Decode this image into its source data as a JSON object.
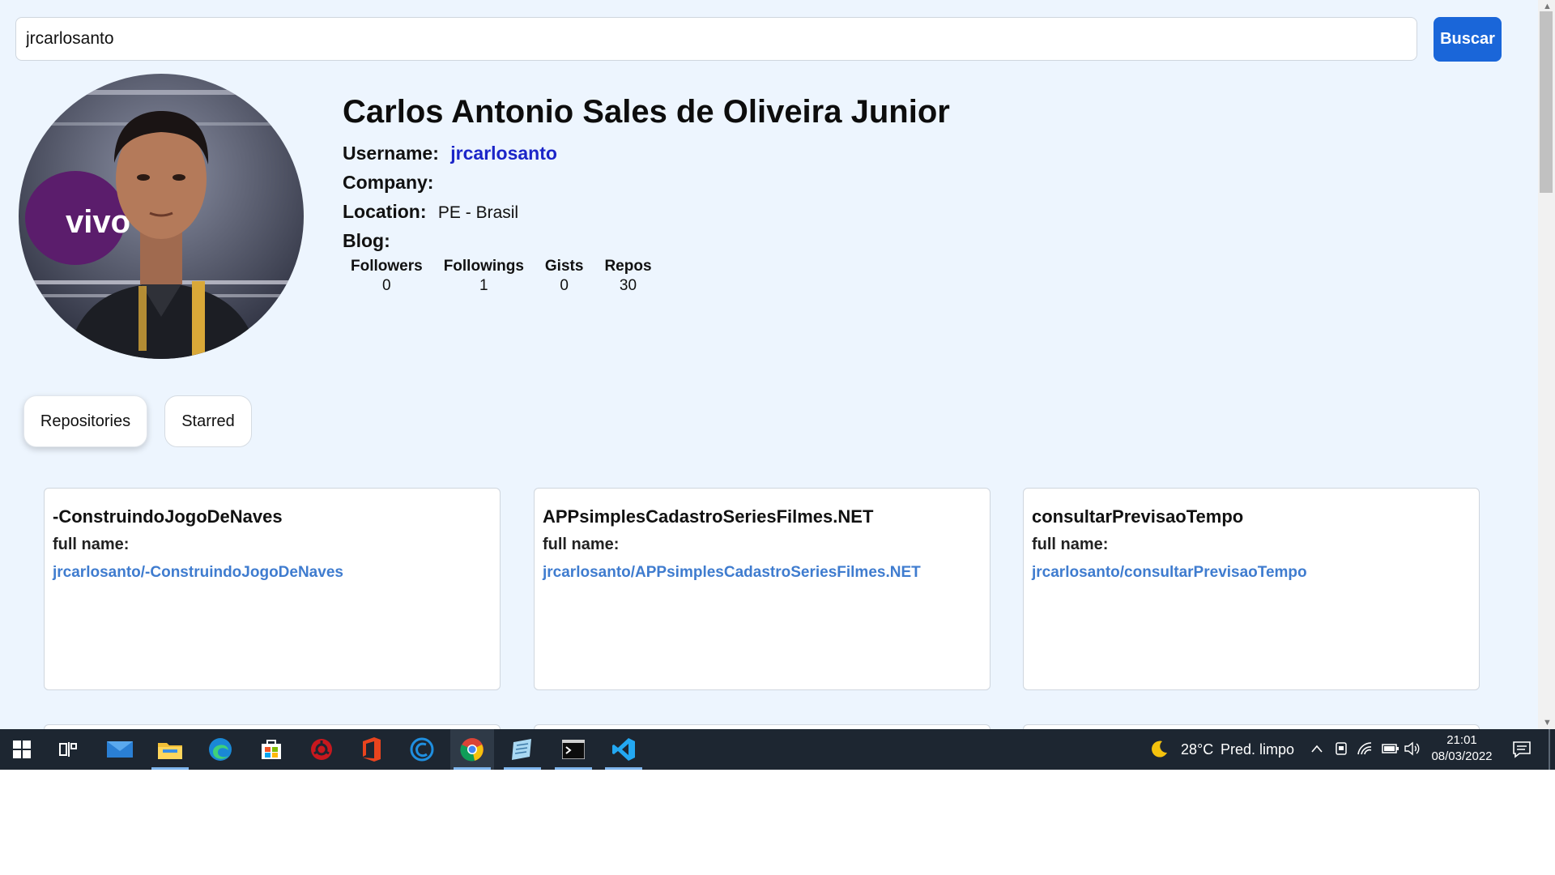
{
  "search": {
    "value": "jrcarlosanto",
    "button_label": "Buscar"
  },
  "profile": {
    "name": "Carlos Antonio Sales de Oliveira Junior",
    "username_label": "Username:",
    "username": "jrcarlosanto",
    "company_label": "Company:",
    "company": "",
    "location_label": "Location:",
    "location": "PE - Brasil",
    "blog_label": "Blog:",
    "blog": "",
    "avatar_text": "vivo",
    "stats": [
      {
        "label": "Followers",
        "value": "0"
      },
      {
        "label": "Followings",
        "value": "1"
      },
      {
        "label": "Gists",
        "value": "0"
      },
      {
        "label": "Repos",
        "value": "30"
      }
    ]
  },
  "tabs": [
    {
      "label": "Repositories",
      "active": true
    },
    {
      "label": "Starred",
      "active": false
    }
  ],
  "repos": [
    {
      "name": "-ConstruindoJogoDeNaves",
      "full_name_label": "full name:",
      "full_name": "jrcarlosanto/-ConstruindoJogoDeNaves"
    },
    {
      "name": "APPsimplesCadastroSeriesFilmes.NET",
      "full_name_label": "full name:",
      "full_name": "jrcarlosanto/APPsimplesCadastroSeriesFilmes.NET"
    },
    {
      "name": "consultarPrevisaoTempo",
      "full_name_label": "full name:",
      "full_name": "jrcarlosanto/consultarPrevisaoTempo"
    }
  ],
  "colors": {
    "accent": "#1a66d9",
    "username_link": "#1b25c8",
    "repo_link": "#3f7ccf",
    "page_bg": "#edf5fe"
  },
  "taskbar": {
    "apps": [
      "windows-start-icon",
      "task-view-icon",
      "mail-icon",
      "file-explorer-icon",
      "edge-icon",
      "microsoft-store-icon",
      "antivirus-icon",
      "office-icon",
      "ccleaner-icon",
      "chrome-icon",
      "notepad-icon",
      "terminal-icon",
      "vscode-icon"
    ],
    "weather_temp": "28°C",
    "weather_desc": "Pred. limpo",
    "time": "21:01",
    "date": "08/03/2022"
  }
}
